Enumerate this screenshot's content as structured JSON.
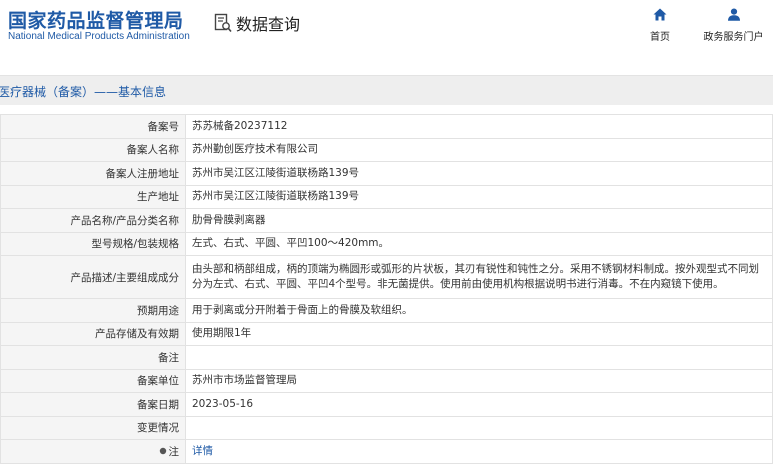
{
  "header": {
    "logo_cn": "国家药品监督管理局",
    "logo_en": "National Medical Products Administration",
    "search_title": "数据查询",
    "nav": [
      {
        "label": "首页",
        "icon": "home-icon"
      },
      {
        "label": "政务服务门户",
        "icon": "user-icon"
      }
    ]
  },
  "section": {
    "title": "医疗器械（备案）——基本信息"
  },
  "rows": [
    {
      "key": "备案号",
      "value": "苏苏械备20237112"
    },
    {
      "key": "备案人名称",
      "value": "苏州勤创医疗技术有限公司"
    },
    {
      "key": "备案人注册地址",
      "value": "苏州市吴江区江陵街道联杨路139号"
    },
    {
      "key": "生产地址",
      "value": "苏州市吴江区江陵街道联杨路139号"
    },
    {
      "key": "产品名称/产品分类名称",
      "value": "肋骨骨膜剥离器"
    },
    {
      "key": "型号规格/包装规格",
      "value": "左式、右式、平圆、平凹100～420mm。"
    },
    {
      "key": "产品描述/主要组成成分",
      "value": "由头部和柄部组成，柄的顶端为椭圆形或弧形的片状板，其刃有锐性和钝性之分。采用不锈钢材料制成。按外观型式不同划分为左式、右式、平圆、平凹4个型号。非无菌提供。使用前由使用机构根据说明书进行消毒。不在内窥镜下使用。"
    },
    {
      "key": "预期用途",
      "value": "用于剥离或分开附着于骨面上的骨膜及软组织。"
    },
    {
      "key": "产品存储及有效期",
      "value": "使用期限1年"
    },
    {
      "key": "备注",
      "value": ""
    },
    {
      "key": "备案单位",
      "value": "苏州市市场监督管理局"
    },
    {
      "key": "备案日期",
      "value": "2023-05-16"
    },
    {
      "key": "变更情况",
      "value": ""
    },
    {
      "key": "注",
      "value": "详情"
    }
  ],
  "colors": {
    "brand_blue": "#1f5aa6",
    "key_bg": "#f5f5f5",
    "band_bg": "#eeeeee",
    "border": "#e2e2e2"
  }
}
